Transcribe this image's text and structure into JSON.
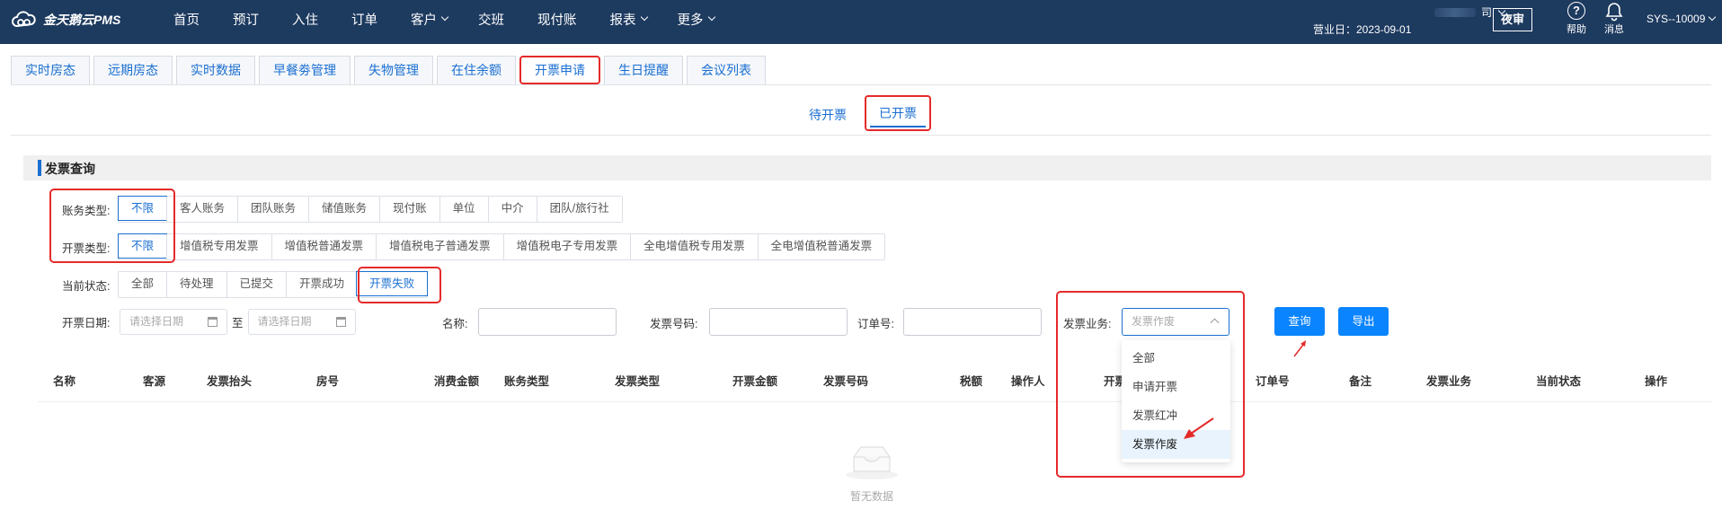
{
  "app": {
    "logo_text": "金天鹅云PMS"
  },
  "nav": [
    {
      "label": "首页",
      "caret": false
    },
    {
      "label": "预订",
      "caret": false
    },
    {
      "label": "入住",
      "caret": false
    },
    {
      "label": "订单",
      "caret": false
    },
    {
      "label": "客户",
      "caret": true
    },
    {
      "label": "交班",
      "caret": false
    },
    {
      "label": "现付账",
      "caret": false
    },
    {
      "label": "报表",
      "caret": true
    },
    {
      "label": "更多",
      "caret": true
    }
  ],
  "header": {
    "hotel_suffix": "司",
    "biz_date": "营业日：2023-09-01",
    "night_audit": "夜审",
    "help": "帮助",
    "messages": "消息",
    "user": "SYS--10009"
  },
  "tabs": [
    "实时房态",
    "远期房态",
    "实时数据",
    "早餐劵管理",
    "失物管理",
    "在住余额",
    "开票申请",
    "生日提醒",
    "会议列表"
  ],
  "active_tab": "开票申请",
  "subtabs": {
    "pending": "待开票",
    "done": "已开票"
  },
  "section_title": "发票查询",
  "filters": {
    "account_type": {
      "label": "账务类型:",
      "options": [
        "不限",
        "客人账务",
        "团队账务",
        "储值账务",
        "现付账",
        "单位",
        "中介",
        "团队/旅行社"
      ]
    },
    "invoice_type": {
      "label": "开票类型:",
      "options": [
        "不限",
        "增值税专用发票",
        "增值税普通发票",
        "增值税电子普通发票",
        "增值税电子专用发票",
        "全电增值税专用发票",
        "全电增值税普通发票"
      ]
    },
    "status": {
      "label": "当前状态:",
      "options": [
        "全部",
        "待处理",
        "已提交",
        "开票成功",
        "开票失败"
      ]
    },
    "date_label": "开票日期:",
    "date_placeholder": "请选择日期",
    "date_to": "至",
    "name_label": "名称:",
    "invoice_no_label": "发票号码:",
    "order_no_label": "订单号:",
    "biz_label": "发票业务:",
    "biz_value": "发票作废",
    "search_btn": "查询",
    "export_btn": "导出"
  },
  "dropdown": [
    "全部",
    "申请开票",
    "发票红冲",
    "发票作废"
  ],
  "columns": [
    "名称",
    "客源",
    "发票抬头",
    "房号",
    "消费金额",
    "账务类型",
    "发票类型",
    "开票金额",
    "发票号码",
    "税额",
    "操作人",
    "开票",
    "订单号",
    "备注",
    "发票业务",
    "当前状态",
    "操作"
  ],
  "empty_text": "暂无数据",
  "colors": {
    "topbar": "#1d3a5f",
    "accent": "#1a6fd1",
    "button": "#0a84ff",
    "highlight": "#e52a2a"
  }
}
